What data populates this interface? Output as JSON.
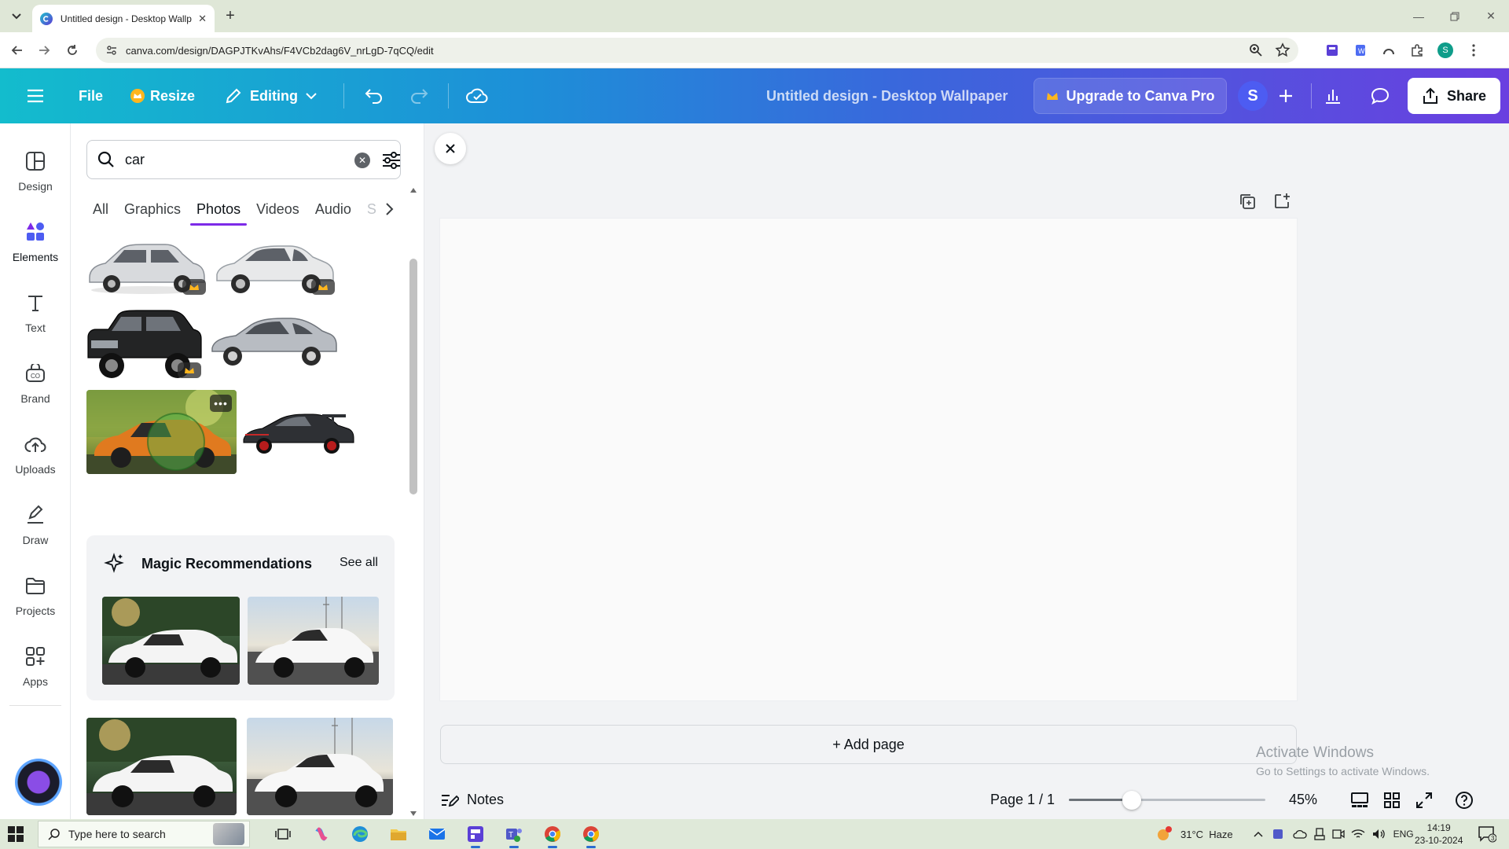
{
  "browser": {
    "tab_title": "Untitled design - Desktop Wallpaper",
    "url": "canva.com/design/DAGPJTKvAhs/F4VCb2dag6V_nrLgD-7qCQ/edit",
    "profile_initial": "S"
  },
  "header": {
    "file_label": "File",
    "resize_label": "Resize",
    "editing_label": "Editing",
    "design_title": "Untitled design - Desktop Wallpaper",
    "upgrade_label": "Upgrade to Canva Pro",
    "avatar_initial": "S",
    "share_label": "Share",
    "gradient_start": "#13bccd",
    "gradient_end": "#6a3fe0"
  },
  "rail": {
    "items": [
      {
        "label": "Design",
        "icon": "design-icon"
      },
      {
        "label": "Elements",
        "icon": "elements-icon"
      },
      {
        "label": "Text",
        "icon": "text-icon"
      },
      {
        "label": "Brand",
        "icon": "brand-icon"
      },
      {
        "label": "Uploads",
        "icon": "uploads-icon"
      },
      {
        "label": "Draw",
        "icon": "draw-icon"
      },
      {
        "label": "Projects",
        "icon": "projects-icon"
      },
      {
        "label": "Apps",
        "icon": "apps-icon"
      }
    ],
    "active": "Elements"
  },
  "panel": {
    "search_value": "car",
    "tabs": [
      "All",
      "Graphics",
      "Photos",
      "Videos",
      "Audio",
      "S"
    ],
    "active_tab": "Photos",
    "magic": {
      "title": "Magic Recommendations",
      "see_all": "See all"
    },
    "accent": "#7d2ae8"
  },
  "canvas": {
    "add_page_label": "+ Add page",
    "watermark_line1": "Activate Windows",
    "watermark_line2": "Go to Settings to activate Windows."
  },
  "footer": {
    "notes_label": "Notes",
    "page_label": "Page 1 / 1",
    "zoom_label": "45%",
    "zoom_fraction": 0.32
  },
  "taskbar": {
    "search_placeholder": "Type here to search",
    "weather": "31°C  Haze",
    "lang": "ENG",
    "time": "14:19",
    "date": "23-10-2024",
    "notif_count": "3"
  }
}
